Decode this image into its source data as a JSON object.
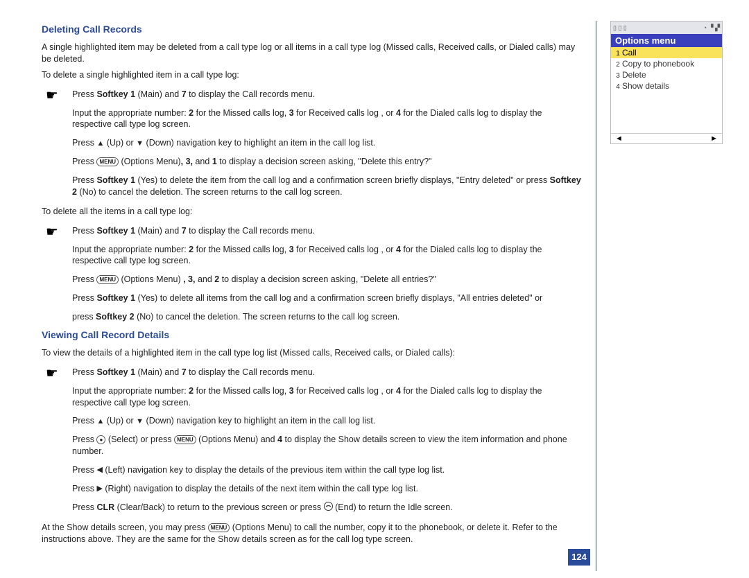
{
  "page_number": "124",
  "section1": {
    "heading": "Deleting Call Records",
    "intro": "A single highlighted item may be deleted from a call type log or all items in a call type log (Missed calls, Received calls, or Dialed calls) may be deleted.",
    "lead1": "To delete a single highlighted item in a call type log:",
    "s1a_pre": "Press ",
    "s1a_b1": "Softkey 1",
    "s1a_mid1": " (Main) and ",
    "s1a_b2": "7",
    "s1a_post": " to display the Call records menu.",
    "s1b_pre": "Input the appropriate number: ",
    "s1b_b1": "2",
    "s1b_mid1": " for the Missed calls log, ",
    "s1b_b2": "3",
    "s1b_mid2": " for Received calls log , or ",
    "s1b_b3": "4",
    "s1b_post": " for the Dialed calls log to display the respective call type log screen.",
    "s1c_pre": "Press ",
    "s1c_mid1": " (Up) or ",
    "s1c_post": " (Down) navigation key to highlight an item in the call log list.",
    "s1d_pre": "Press ",
    "s1d_menu": "MENU",
    "s1d_mid1": " (Options Menu)",
    "s1d_b1": ", 3,",
    "s1d_mid2": " and ",
    "s1d_b2": "1",
    "s1d_post": " to display a decision screen asking, \"Delete this entry?\"",
    "s1e_pre": "Press ",
    "s1e_b1": "Softkey 1",
    "s1e_mid1": " (Yes) to delete the item from the call log and a confirmation screen briefly displays, \"Entry deleted\" or press ",
    "s1e_b2": "Softkey 2",
    "s1e_post": " (No) to cancel the deletion. The screen returns to the call log screen.",
    "lead2": "To delete all the items in a call type log:",
    "s2a_pre": "Press ",
    "s2a_b1": "Softkey 1",
    "s2a_mid1": " (Main) and ",
    "s2a_b2": "7",
    "s2a_post": " to display the Call records menu.",
    "s2b_pre": "Input the appropriate number: ",
    "s2b_b1": "2",
    "s2b_mid1": " for the Missed calls log, ",
    "s2b_b2": "3",
    "s2b_mid2": " for Received calls log , or ",
    "s2b_b3": "4",
    "s2b_post": " for the Dialed calls log to display the respective call type log screen.",
    "s2c_pre": "Press ",
    "s2c_mid1": " (Options Menu) ",
    "s2c_b1": ", 3,",
    "s2c_mid2": " and ",
    "s2c_b2": "2",
    "s2c_post": " to display a decision screen asking, \"Delete all entries?\"",
    "s2d_pre": "Press ",
    "s2d_b1": "Softkey 1",
    "s2d_post": " (Yes) to delete all items from the call log and a confirmation screen briefly displays, \"All entries deleted\" or",
    "s2e_pre": "press ",
    "s2e_b1": "Softkey 2",
    "s2e_post": " (No) to cancel the deletion. The screen returns to the call log screen."
  },
  "section2": {
    "heading": "Viewing Call Record Details",
    "intro": "To view the details of a highlighted item in the call type log list (Missed calls, Received calls, or Dialed calls):",
    "v1_pre": "Press ",
    "v1_b1": "Softkey 1",
    "v1_mid1": " (Main) and ",
    "v1_b2": "7",
    "v1_post": " to display the Call records menu.",
    "v2_pre": "Input the appropriate number: ",
    "v2_b1": "2",
    "v2_mid1": " for the Missed calls log, ",
    "v2_b2": "3",
    "v2_mid2": " for Received calls log , or ",
    "v2_b3": "4",
    "v2_post": " for the Dialed calls log to display the respective call type log screen.",
    "v3_pre": "Press ",
    "v3_mid1": " (Up) or ",
    "v3_post": " (Down) navigation key to highlight an item in the call log list.",
    "v4_pre": "Press ",
    "v4_mid1": " (Select) or press ",
    "v4_mid2": " (Options Menu) and ",
    "v4_b1": "4",
    "v4_post": " to display the Show details screen to view the item information and phone number.",
    "v5_pre": "Press ",
    "v5_post": " (Left) navigation key to display the details of the previous item within the call type log list.",
    "v6_pre": "Press ",
    "v6_post": " (Right) navigation to display the details of the next item within the call type log list.",
    "v7_pre": "Press ",
    "v7_b1": "CLR",
    "v7_mid1": " (Clear/Back) to return to the previous screen or press ",
    "v7_post": " (End) to return the Idle screen.",
    "outro_pre": "At the Show details screen, you may press ",
    "outro_post": " (Options Menu) to call the number, copy it to the phonebook, or delete it. Refer to the instructions above. They are the same for the Show details screen as for the call log type screen."
  },
  "phone": {
    "title": "Options menu",
    "items": [
      {
        "n": "1",
        "label": "Call"
      },
      {
        "n": "2",
        "label": "Copy to phonebook"
      },
      {
        "n": "3",
        "label": "Delete"
      },
      {
        "n": "4",
        "label": "Show details"
      }
    ],
    "soft_left": "◄",
    "soft_right": "►"
  },
  "keys": {
    "menu": "MENU",
    "select": "●"
  }
}
